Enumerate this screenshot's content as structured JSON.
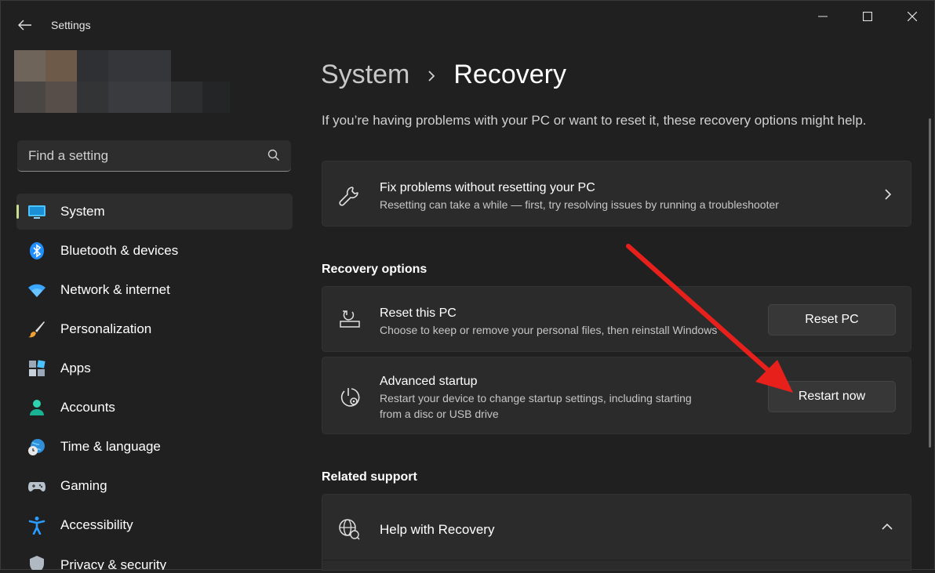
{
  "window": {
    "title": "Settings"
  },
  "search": {
    "placeholder": "Find a setting"
  },
  "sidebar": {
    "items": [
      {
        "label": "System",
        "icon": "system-icon",
        "active": true
      },
      {
        "label": "Bluetooth & devices",
        "icon": "bluetooth-icon"
      },
      {
        "label": "Network & internet",
        "icon": "wifi-icon"
      },
      {
        "label": "Personalization",
        "icon": "brush-icon"
      },
      {
        "label": "Apps",
        "icon": "apps-icon"
      },
      {
        "label": "Accounts",
        "icon": "person-icon"
      },
      {
        "label": "Time & language",
        "icon": "globe-clock-icon"
      },
      {
        "label": "Gaming",
        "icon": "gamepad-icon"
      },
      {
        "label": "Accessibility",
        "icon": "accessibility-icon"
      },
      {
        "label": "Privacy & security",
        "icon": "shield-icon"
      }
    ]
  },
  "breadcrumb": {
    "parent": "System",
    "separator": "›",
    "current": "Recovery"
  },
  "intro": "If you’re having problems with your PC or want to reset it, these recovery options might help.",
  "fix_card": {
    "title": "Fix problems without resetting your PC",
    "subtitle": "Resetting can take a while — first, try resolving issues by running a troubleshooter"
  },
  "recovery_options": {
    "heading": "Recovery options",
    "reset": {
      "title": "Reset this PC",
      "subtitle": "Choose to keep or remove your personal files, then reinstall Windows",
      "button": "Reset PC"
    },
    "advanced": {
      "title": "Advanced startup",
      "subtitle_line1": "Restart your device to change startup settings, including starting",
      "subtitle_line2": "from a disc or USB drive",
      "button": "Restart now"
    }
  },
  "related_support": {
    "heading": "Related support",
    "help": {
      "title": "Help with Recovery"
    }
  },
  "colors": {
    "background": "#202020",
    "card": "#2b2b2b",
    "accent_indicator": "#c7dd8f",
    "annotation_arrow": "#e8201c"
  }
}
